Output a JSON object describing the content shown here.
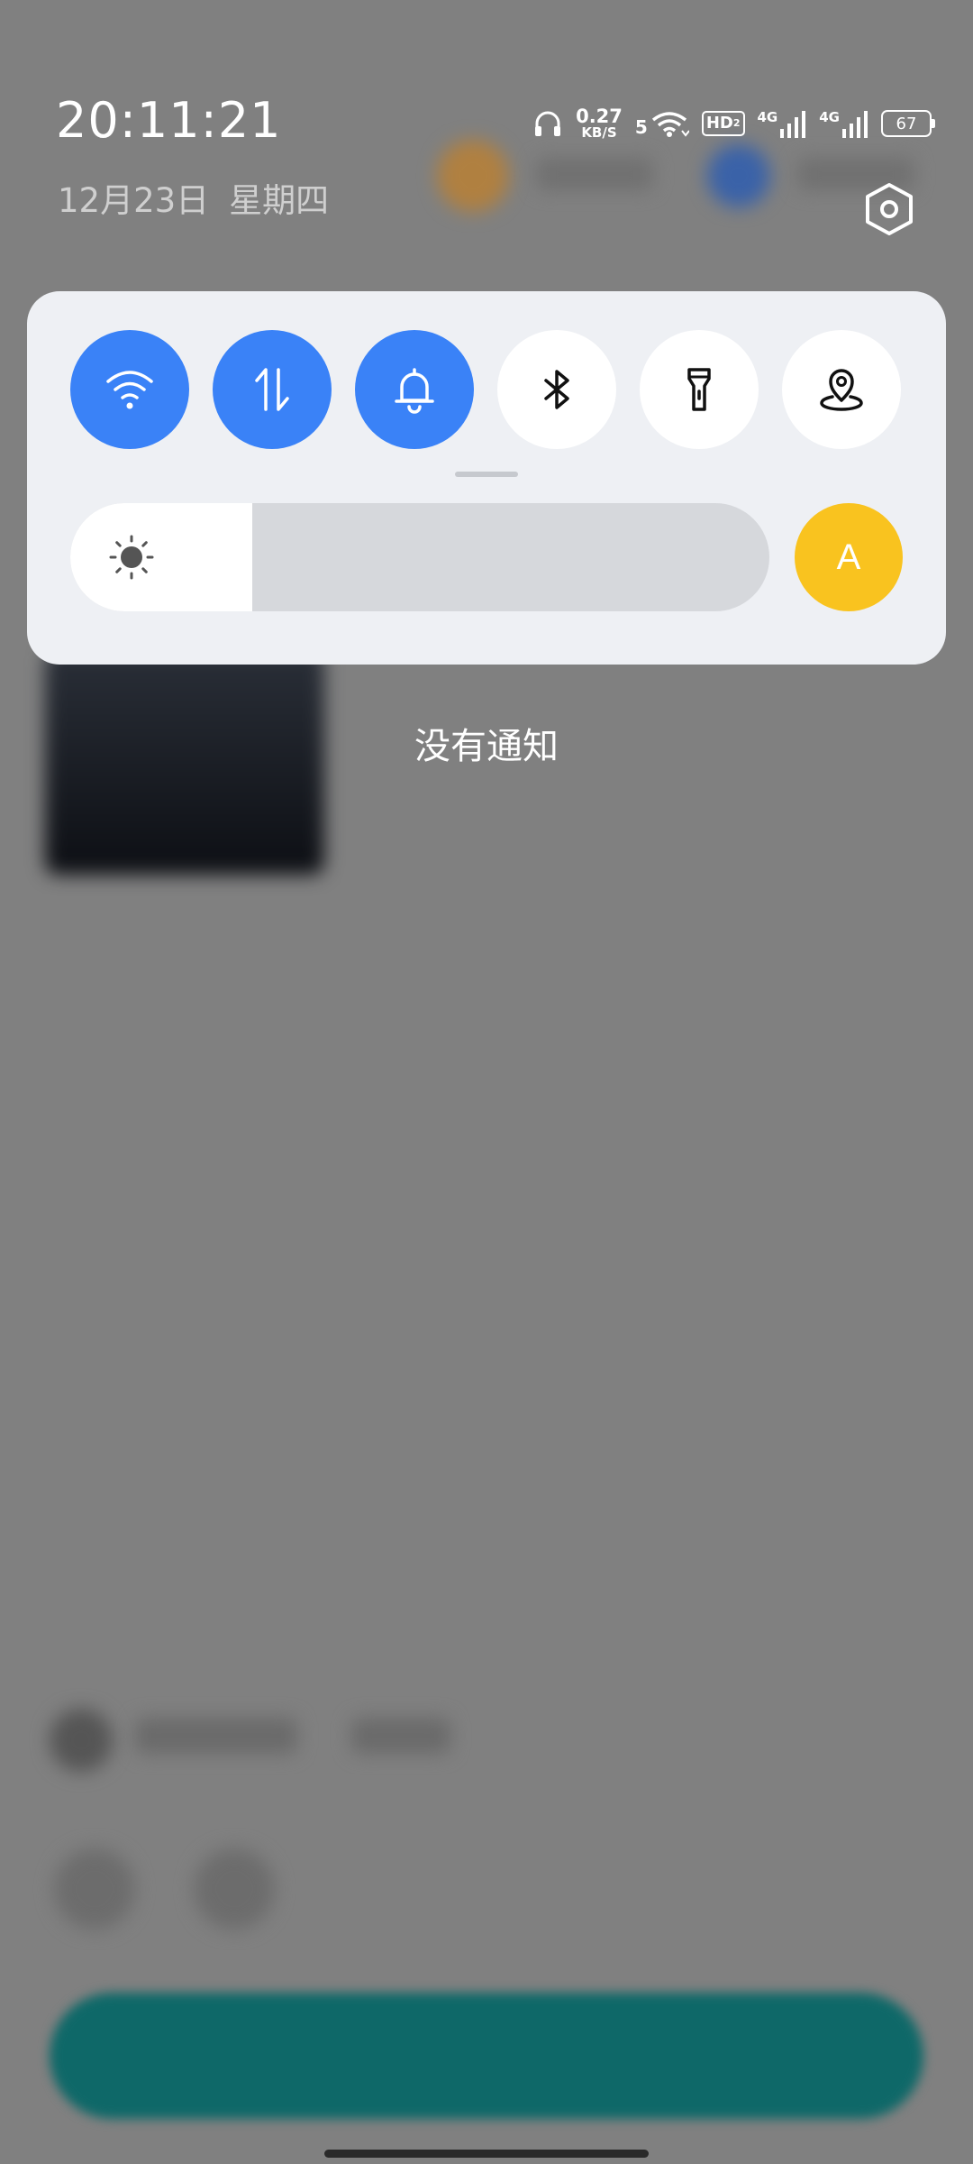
{
  "header": {
    "time": "20:11:21",
    "date": "12月23日",
    "weekday": "星期四"
  },
  "status_bar": {
    "net_speed_value": "0.27",
    "net_speed_unit": "KB/S",
    "wifi_label": "5",
    "hd_label": "HD",
    "hd_sub": "2",
    "sim1_label": "4G",
    "sim2_label": "4G",
    "battery": "67"
  },
  "quick_toggles": [
    {
      "name": "wifi",
      "icon": "wifi-icon",
      "state": "on"
    },
    {
      "name": "mobile-data",
      "icon": "data-arrows-icon",
      "state": "on"
    },
    {
      "name": "sound",
      "icon": "bell-icon",
      "state": "on"
    },
    {
      "name": "bluetooth",
      "icon": "bluetooth-icon",
      "state": "off"
    },
    {
      "name": "flashlight",
      "icon": "flashlight-icon",
      "state": "off"
    },
    {
      "name": "location",
      "icon": "location-icon",
      "state": "off"
    }
  ],
  "brightness": {
    "level": 0.26,
    "auto_label": "A"
  },
  "notifications": {
    "empty_text": "没有通知"
  },
  "colors": {
    "toggle_on": "#3a82f7",
    "auto_brightness": "#f9c31f",
    "panel_bg": "#eef0f4",
    "backdrop": "#808080"
  }
}
